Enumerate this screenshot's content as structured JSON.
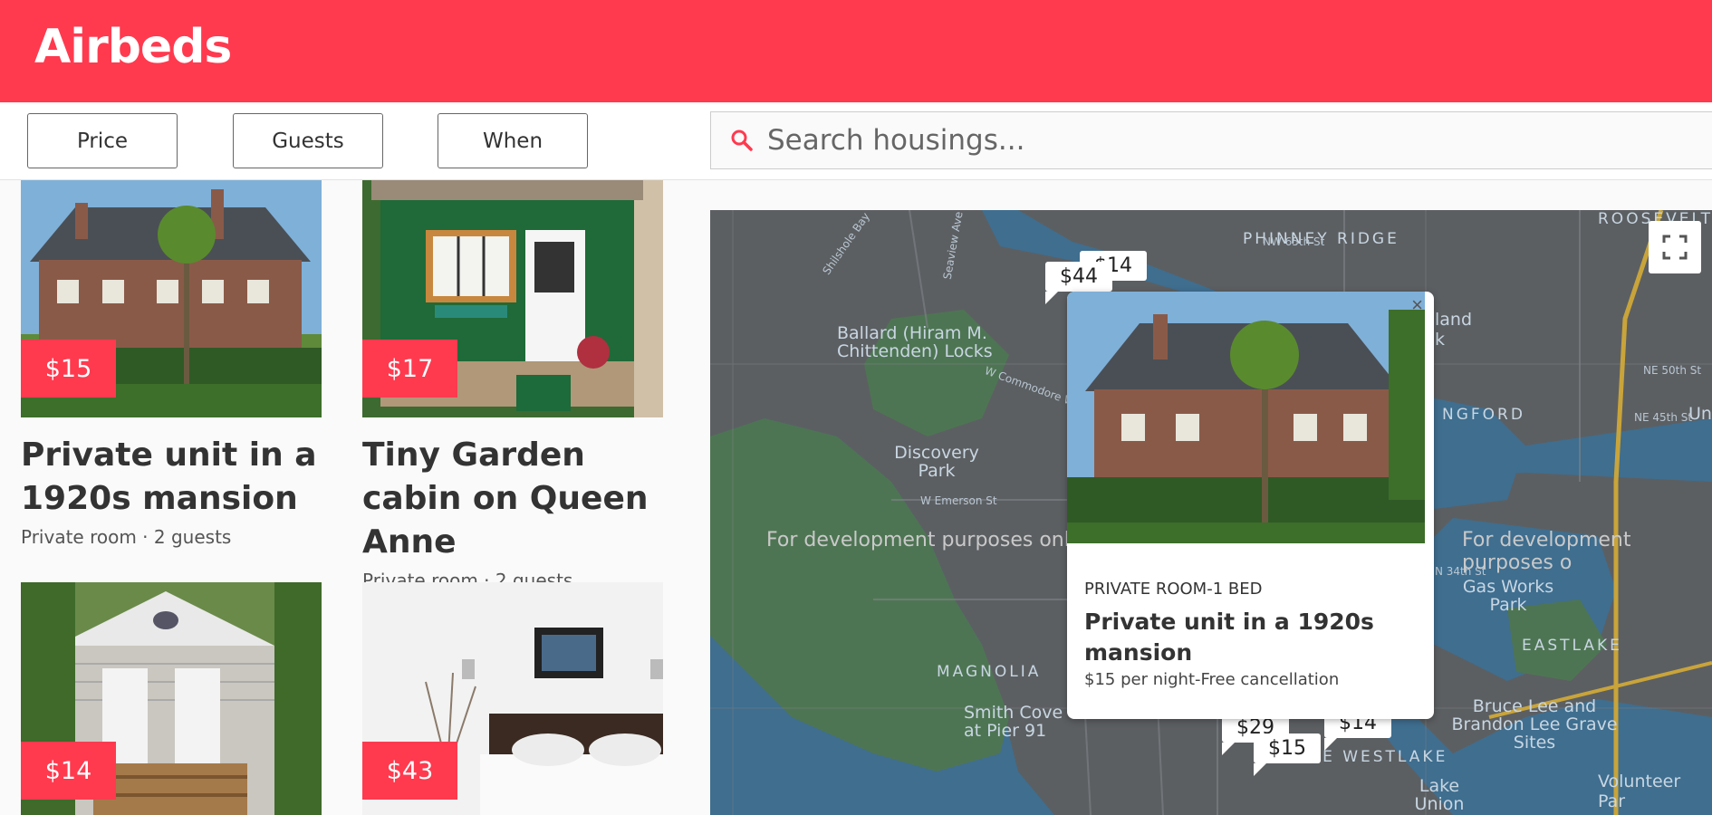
{
  "app": {
    "title": "Airbeds"
  },
  "filters": {
    "price_label": "Price",
    "guests_label": "Guests",
    "when_label": "When"
  },
  "search": {
    "placeholder": "Search housings...",
    "icon": "search-icon"
  },
  "listings": [
    {
      "price": "$15",
      "title": "Private unit in a 1920s mansion",
      "subtitle": "Private room · 2 guests"
    },
    {
      "price": "$17",
      "title": "Tiny Garden cabin on Queen Anne",
      "subtitle": "Private room · 2 guests"
    },
    {
      "price": "$14",
      "title": "",
      "subtitle": ""
    },
    {
      "price": "$43",
      "title": "",
      "subtitle": ""
    }
  ],
  "map": {
    "watermark_left": "For development purposes only",
    "watermark_right": "For development purposes o",
    "pins": [
      "$44",
      "$14",
      "$14",
      "$15",
      "$29"
    ],
    "labels": {
      "phinney": "PHINNEY RIDGE",
      "ballard": "Ballard (Hiram M. Chittenden) Locks",
      "discovery": "Discovery Park",
      "magnolia": "MAGNOLIA",
      "smith": "Smith Cove Terminal at Pier 91",
      "gasworks": "Gas Works Park",
      "eastlake": "EASTLAKE",
      "brucelee": "Bruce Lee and Brandon Lee Grave Sites",
      "annewestlake": "ANNE WESTLAKE",
      "lakeunion": "Lake Union Park",
      "volunteer": "Volunteer Par",
      "roosevelt": "ROOSEVELT",
      "ngford": "NGFORD",
      "land": "land",
      "k": "k",
      "un": "Un"
    },
    "streets": {
      "nw65": "NW 65th St",
      "nw50": "NE 50th St",
      "ne45": "NE 45th St",
      "n34": "N 34th St",
      "emerson": "W Emerson St",
      "commodore": "W Commodore Way",
      "shilshole": "Shilshole Bay",
      "seaview": "Seaview Ave NW"
    }
  },
  "popup": {
    "category": "PRIVATE ROOM-1 BED",
    "title": "Private unit in a 1920s mansion",
    "description": "$15 per night-Free cancellation",
    "close": "×"
  },
  "colors": {
    "brand": "#ff3a4f",
    "water": "#3f6e8f",
    "land": "#5f6163",
    "park": "#4f7a55"
  }
}
